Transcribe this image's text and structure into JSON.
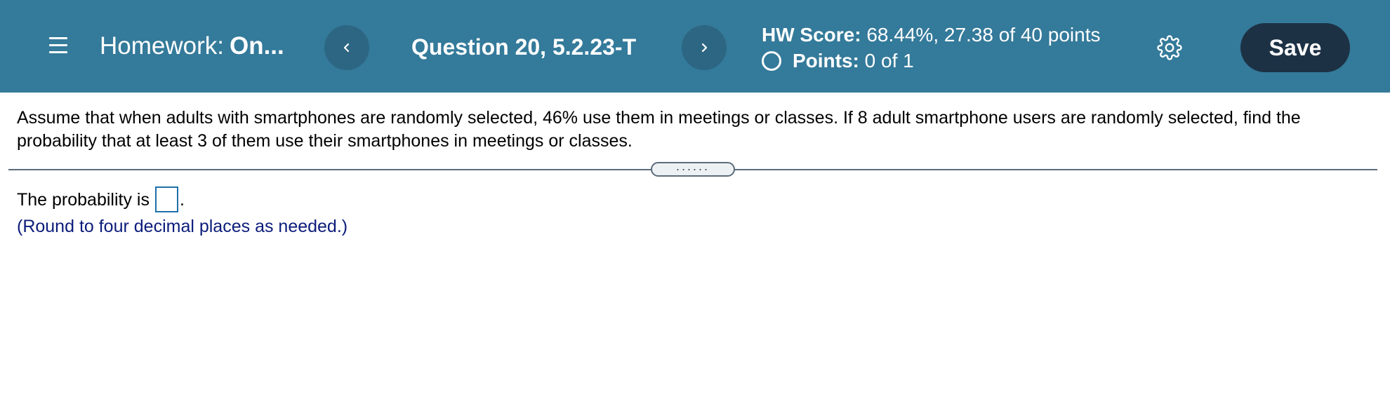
{
  "header": {
    "homework_prefix": "Homework:",
    "homework_name": "On...",
    "question_title": "Question 20, 5.2.23-T",
    "hw_score_label": "HW Score:",
    "hw_score_value": "68.44%, 27.38 of 40 points",
    "points_label": "Points:",
    "points_value": "0 of 1",
    "save_label": "Save",
    "colors": {
      "topbar": "#347a9a",
      "nav_button": "#2d6683",
      "save_button": "#1d3145"
    },
    "icons": [
      "menu-icon",
      "chevron-left-icon",
      "chevron-right-icon",
      "radio-icon",
      "gear-icon"
    ]
  },
  "question": {
    "text": "Assume that when adults with smartphones are randomly selected, 46% use them in meetings or classes. If 8 adult smartphone users are randomly selected, find the probability that at least 3 of them use their smartphones in meetings or classes.",
    "divider_handle": "......"
  },
  "answer": {
    "prompt": "The probability is",
    "value": "",
    "suffix": ".",
    "hint": "(Round to four decimal places as needed.)"
  }
}
